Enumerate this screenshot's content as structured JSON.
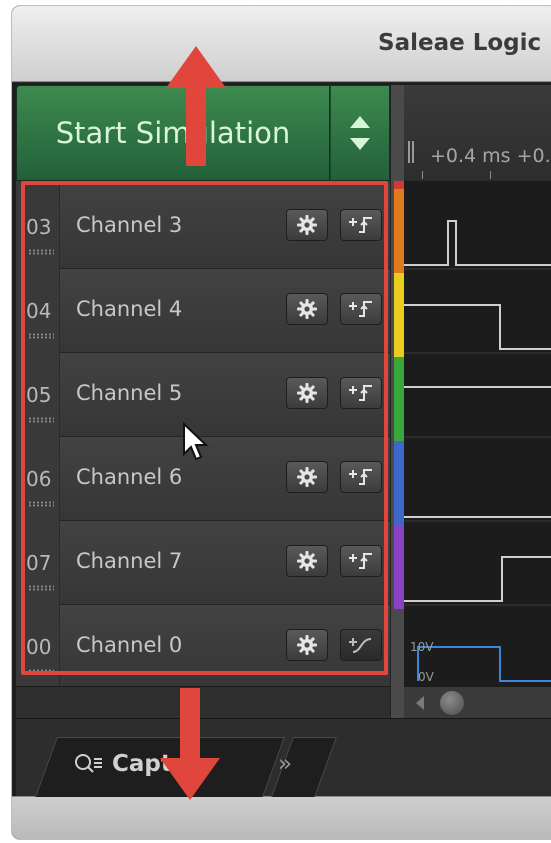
{
  "window": {
    "title": "Saleae Logic"
  },
  "simulation": {
    "start_label": "Start Simulation"
  },
  "timeline": {
    "time_label": "+0.4 ms  +0.…"
  },
  "channels": [
    {
      "index": "03",
      "name": "Channel 3",
      "color": "#e07a1a",
      "trigger": "rising-edge-icon"
    },
    {
      "index": "04",
      "name": "Channel 4",
      "color": "#e8cf1f",
      "trigger": "rising-edge-icon"
    },
    {
      "index": "05",
      "name": "Channel 5",
      "color": "#3aa73a",
      "trigger": "rising-edge-icon"
    },
    {
      "index": "06",
      "name": "Channel 6",
      "color": "#3f66c9",
      "trigger": "rising-edge-icon"
    },
    {
      "index": "07",
      "name": "Channel 7",
      "color": "#8a42c2",
      "trigger": "rising-edge-icon"
    },
    {
      "index": "00",
      "name": "Channel 0",
      "color": "#d23a3a",
      "trigger": "analog-icon"
    }
  ],
  "analog": {
    "label_top": "10V",
    "label_bottom": "0V"
  },
  "tabs": {
    "capture_label": "Capt",
    "more_label": "»"
  },
  "annotations": {
    "frame_color": "#e0463c",
    "arrow_color": "#e0463c"
  }
}
